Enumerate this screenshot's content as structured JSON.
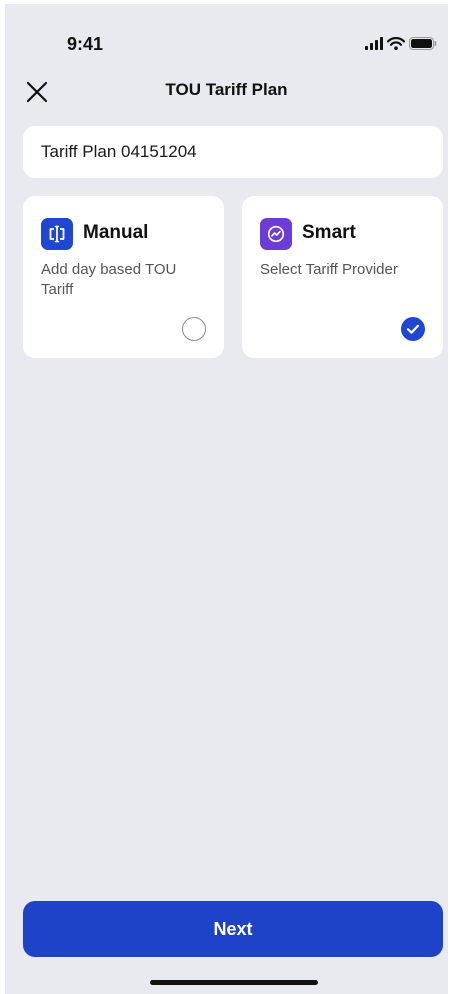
{
  "status_bar": {
    "time": "9:41",
    "icons": [
      "signal-icon",
      "wifi-icon",
      "battery-icon"
    ]
  },
  "header": {
    "title": "TOU Tariff Plan",
    "close_icon": "close-icon"
  },
  "plan_name": {
    "value": "Tariff Plan 04151204"
  },
  "options": [
    {
      "title": "Manual",
      "description": "Add day based TOU Tariff",
      "icon": "manual-split-icon",
      "selected": false,
      "icon_color": "#1f47d1"
    },
    {
      "title": "Smart",
      "description": "Select Tariff Provider",
      "icon": "smart-trend-icon",
      "selected": true,
      "icon_color": "#6d3bd6"
    }
  ],
  "footer": {
    "next_label": "Next"
  },
  "colors": {
    "accent": "#1e43c8",
    "background": "#e9eaef"
  }
}
